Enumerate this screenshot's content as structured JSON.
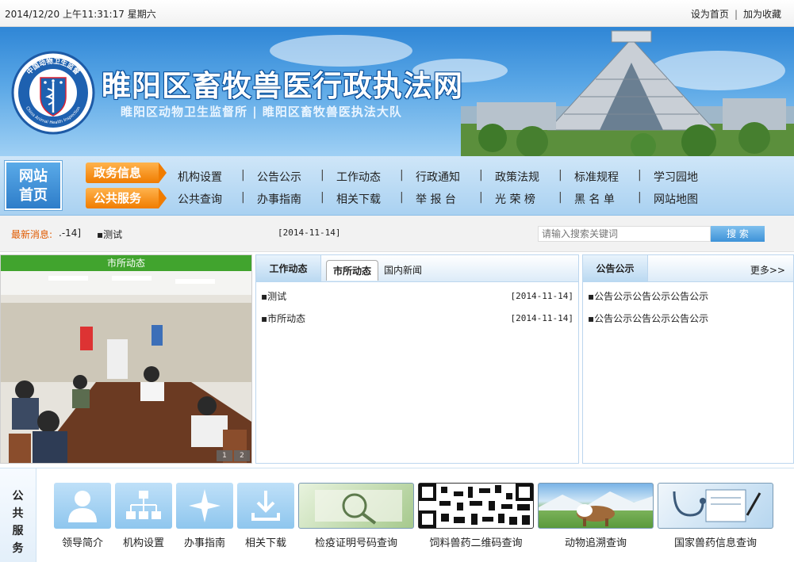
{
  "topbar": {
    "datetime": "2014/12/20 上午11:31:17 星期六",
    "set_home": "设为首页",
    "separator": "|",
    "add_fav": "加为收藏"
  },
  "banner": {
    "title": "睢阳区畜牧兽医行政执法网",
    "subtitle": "睢阳区动物卫生监督所 | 睢阳区畜牧兽医执法大队",
    "logo_ring_top": "中国动物卫生监督",
    "logo_ring_bottom": "China Animal Health Inspection"
  },
  "nav": {
    "home_line1": "网站",
    "home_line2": "首页",
    "tag1": "政务信息",
    "tag2": "公共服务",
    "row1": [
      "机构设置",
      "公告公示",
      "工作动态",
      "行政通知",
      "政策法规",
      "标准规程",
      "学习园地"
    ],
    "row2": [
      "公共查询",
      "办事指南",
      "相关下载",
      "举 报 台",
      "光 荣 榜",
      "黑 名 单",
      "网站地图"
    ]
  },
  "news": {
    "label": "最新消息:",
    "prefix": ".-14]",
    "item": "▪测试",
    "date": "[2014-11-14]",
    "search_placeholder": "请输入搜索关键词",
    "search_button": "搜 索"
  },
  "photo_panel": {
    "title": "市所动态",
    "pages": [
      "1",
      "2"
    ]
  },
  "work_panel": {
    "tab1": "工作动态",
    "tab2": "市所动态",
    "tab3": "国内新闻",
    "rows": [
      {
        "title": "▪测试",
        "date": "[2014-11-14]"
      },
      {
        "title": "▪市所动态",
        "date": "[2014-11-14]"
      }
    ]
  },
  "notice_panel": {
    "title": "公告公示",
    "more": "更多>>",
    "rows": [
      {
        "title": "▪公告公示公告公示公告公示"
      },
      {
        "title": "▪公告公示公告公示公告公示"
      }
    ]
  },
  "services": {
    "label": "公共服务",
    "items": [
      "领导简介",
      "机构设置",
      "办事指南",
      "相关下载",
      "检疫证明号码查询",
      "饲料兽药二维码查询",
      "动物追溯查询",
      "国家兽药信息查询"
    ]
  },
  "colors": {
    "brand_blue": "#2e7dc9",
    "tag_orange": "#f07c00",
    "photo_green": "#41a42e",
    "news_label": "#e05a00"
  }
}
